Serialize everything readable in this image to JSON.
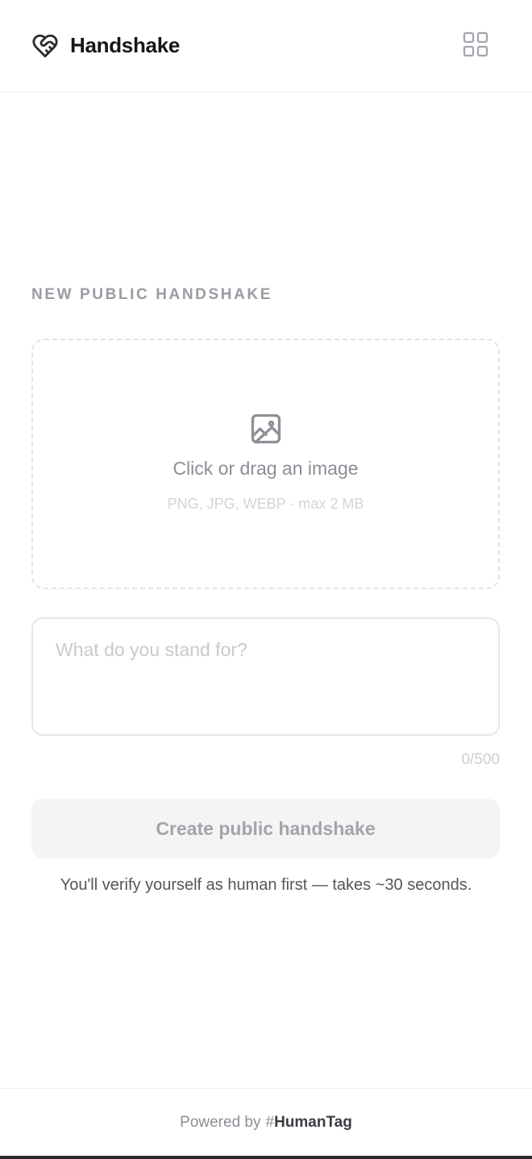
{
  "header": {
    "brand_name": "Handshake",
    "logo_icon": "heart-handshake-icon",
    "menu_icon": "grid-icon"
  },
  "main": {
    "section_title": "NEW PUBLIC HANDSHAKE",
    "dropzone": {
      "icon": "image-icon",
      "title": "Click or drag an image",
      "hint": "PNG, JPG, WEBP · max 2 MB"
    },
    "statement": {
      "placeholder": "What do you stand for?",
      "value": "",
      "char_count": "0/500"
    },
    "create_button_label": "Create public handshake",
    "verify_note": "You'll verify yourself as human first — takes ~30 seconds."
  },
  "footer": {
    "prefix": "Powered by",
    "hash": "#",
    "brand": "HumanTag"
  },
  "colors": {
    "text_primary": "#16161a",
    "text_muted": "#9b9ba3",
    "border": "#e6e6e9",
    "button_disabled_bg": "#f4f4f5"
  }
}
